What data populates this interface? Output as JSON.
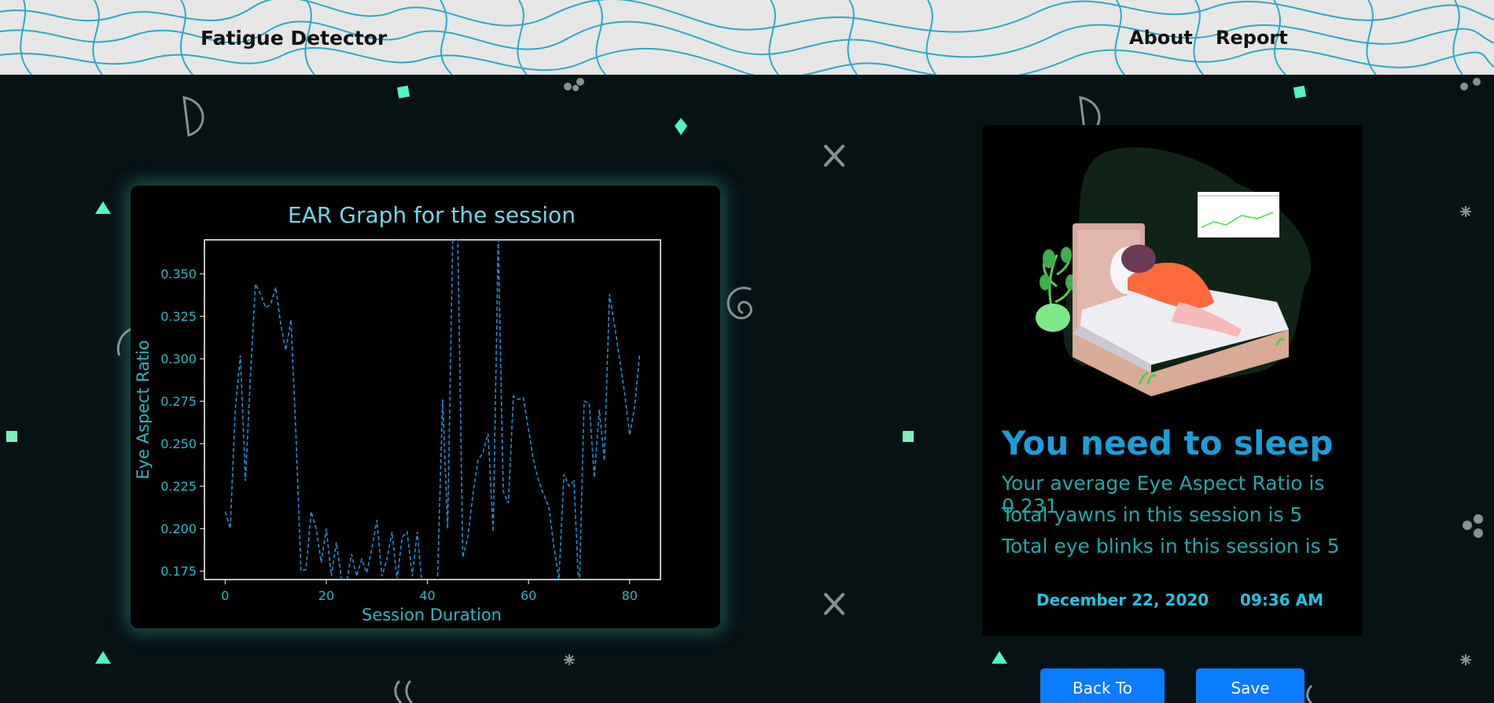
{
  "navbar": {
    "brand": "Fatigue Detector",
    "links": [
      {
        "label": "About"
      },
      {
        "label": "Report"
      }
    ]
  },
  "colors": {
    "navbar_bg": "#e6e6e6",
    "page_bg": "#061214",
    "accent_teal": "#4ff5c8",
    "heading_blue": "#1a9fd8",
    "stat_text": "#1fa8a8",
    "button_blue": "#0b7bff",
    "line_color": "#1f8fd0"
  },
  "chart_data": {
    "type": "line",
    "title": "EAR Graph for the session",
    "xlabel": "Session Duration",
    "ylabel": "Eye Aspect Ratio",
    "xlim": [
      -4.1,
      86.1
    ],
    "ylim": [
      0.17,
      0.37
    ],
    "xticks": [
      0,
      20,
      40,
      60,
      80
    ],
    "yticks": [
      0.175,
      0.2,
      0.225,
      0.25,
      0.275,
      0.3,
      0.325,
      0.35
    ],
    "ytick_labels": [
      "0.175",
      "0.200",
      "0.225",
      "0.250",
      "0.275",
      "0.300",
      "0.325",
      "0.350"
    ],
    "line_style": "dashed",
    "x": [
      0,
      1,
      2,
      3,
      4,
      5,
      6,
      7,
      8,
      9,
      10,
      11,
      12,
      13,
      14,
      15,
      16,
      17,
      18,
      19,
      20,
      21,
      22,
      23,
      24,
      25,
      26,
      27,
      28,
      29,
      30,
      31,
      32,
      33,
      34,
      35,
      36,
      37,
      38,
      39,
      40,
      41,
      42,
      43,
      44,
      45,
      46,
      47,
      48,
      49,
      50,
      51,
      52,
      53,
      54,
      55,
      56,
      57,
      58,
      59,
      60,
      61,
      62,
      63,
      64,
      65,
      66,
      67,
      68,
      69,
      70,
      71,
      72,
      73,
      74,
      75,
      76,
      77,
      78,
      79,
      80,
      81,
      82
    ],
    "values": [
      0.21,
      0.2,
      0.27,
      0.302,
      0.228,
      0.29,
      0.344,
      0.338,
      0.33,
      0.332,
      0.342,
      0.32,
      0.305,
      0.323,
      0.255,
      0.175,
      0.176,
      0.21,
      0.2,
      0.18,
      0.2,
      0.172,
      0.192,
      0.17,
      0.168,
      0.185,
      0.172,
      0.182,
      0.174,
      0.188,
      0.205,
      0.172,
      0.182,
      0.198,
      0.17,
      0.195,
      0.198,
      0.172,
      0.198,
      0.165,
      0.16,
      0.155,
      0.17,
      0.276,
      0.2,
      0.37,
      0.37,
      0.183,
      0.195,
      0.22,
      0.24,
      0.245,
      0.256,
      0.198,
      0.37,
      0.222,
      0.215,
      0.278,
      0.276,
      0.277,
      0.258,
      0.24,
      0.228,
      0.22,
      0.213,
      0.19,
      0.17,
      0.232,
      0.225,
      0.228,
      0.16,
      0.275,
      0.274,
      0.23,
      0.27,
      0.24,
      0.338,
      0.32,
      0.3,
      0.28,
      0.255,
      0.272,
      0.303
    ]
  },
  "report": {
    "verdict": "You need to sleep",
    "avg_ear_text": "Your average Eye Aspect Ratio is 0.231",
    "yawns_text": "Total yawns in this session is 5",
    "blinks_text": "Total eye blinks in this session is 5",
    "date": "December 22, 2020",
    "time": "09:36 AM"
  },
  "buttons": {
    "back_home": "Back To Home",
    "save_report": "Save Report"
  },
  "icons": {
    "illustration": "woman-sleeping-in-bed-illustration",
    "decorations": [
      "teal-square-icon",
      "teal-triangle-icon",
      "teal-diamond-icon",
      "x-icon",
      "half-circle-icon",
      "sparkle-icon",
      "dots-icon",
      "swirl-icon",
      "quote-icon"
    ]
  }
}
